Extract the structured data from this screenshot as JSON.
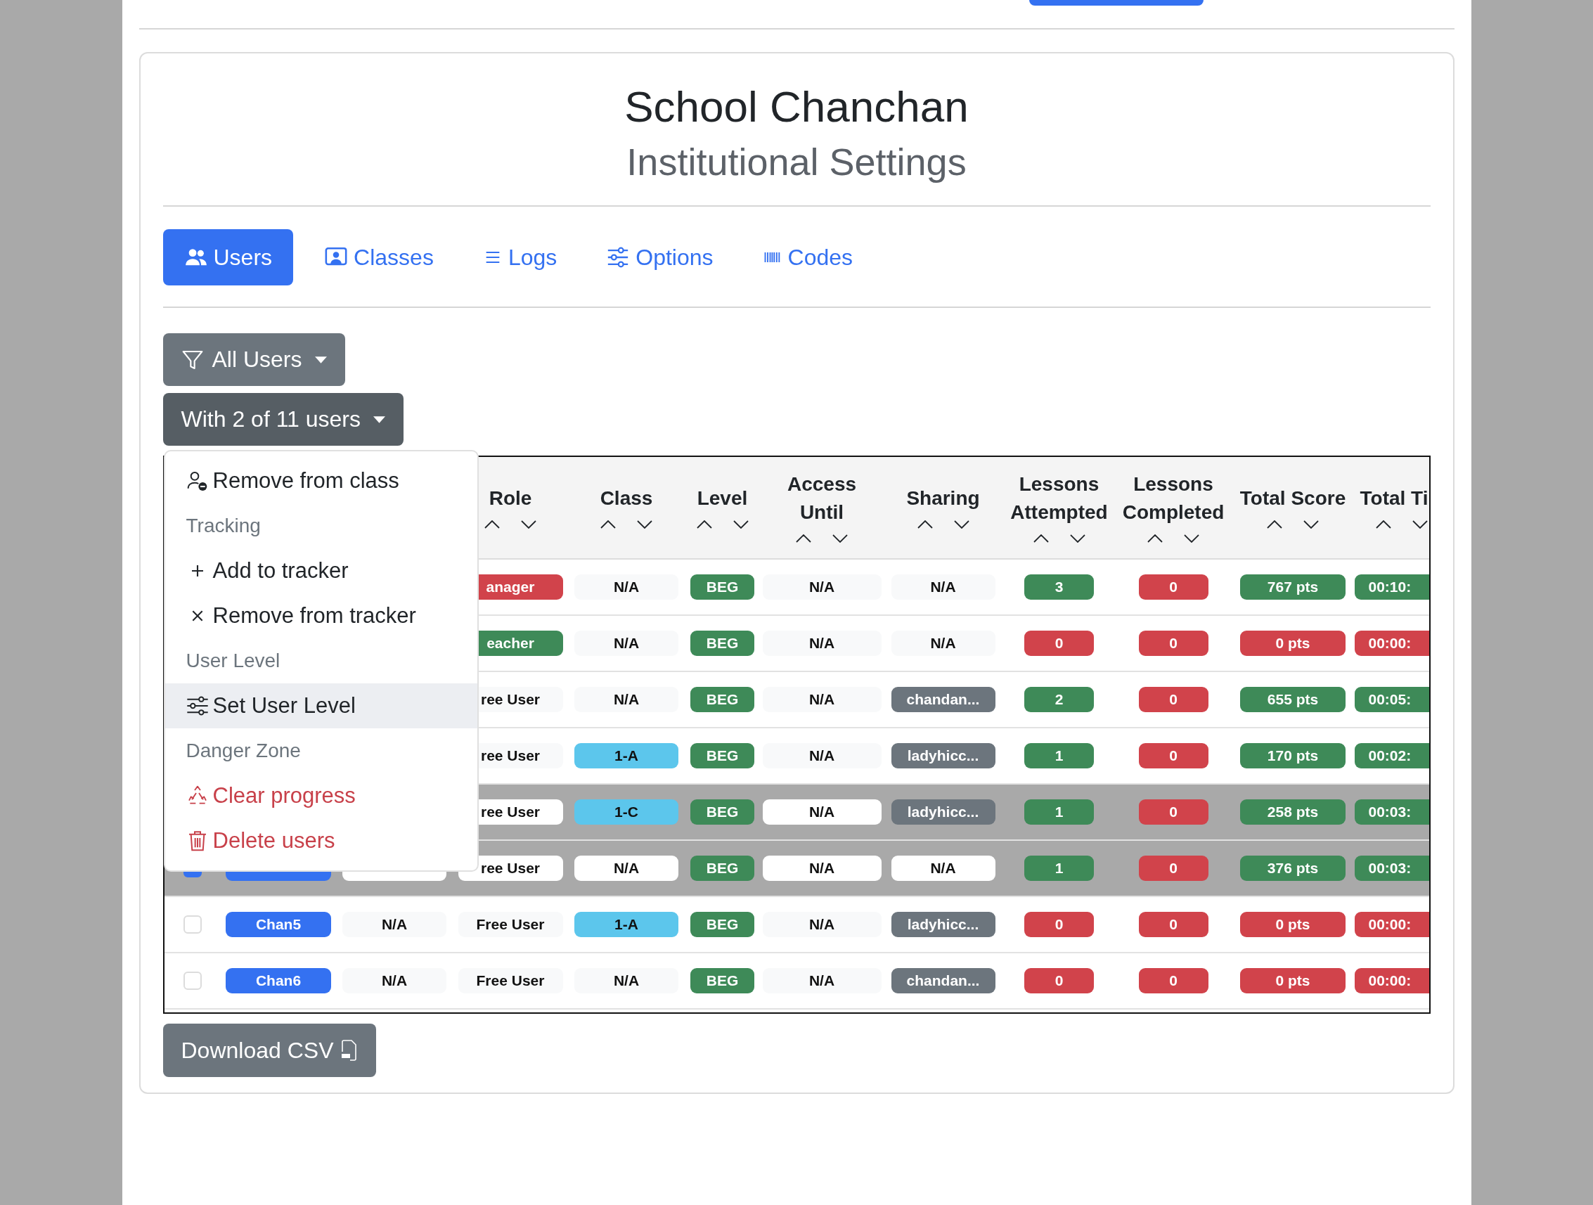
{
  "header": {
    "title": "School Chanchan",
    "subtitle": "Institutional Settings"
  },
  "tabs": [
    {
      "label": "Users",
      "selected": true
    },
    {
      "label": "Classes",
      "selected": false
    },
    {
      "label": "Logs",
      "selected": false
    },
    {
      "label": "Options",
      "selected": false
    },
    {
      "label": "Codes",
      "selected": false
    }
  ],
  "filters": [
    {
      "label": "All Users",
      "kind": "filter"
    },
    {
      "label": "With 2 of 11 users",
      "kind": "action"
    }
  ],
  "action_menu": [
    {
      "kind": "item",
      "label": "Remove from class",
      "selected": false
    },
    {
      "kind": "header",
      "label": "Tracking"
    },
    {
      "kind": "item",
      "label": "Add to tracker",
      "selected": false
    },
    {
      "kind": "item",
      "label": "Remove from tracker",
      "selected": false
    },
    {
      "kind": "header",
      "label": "User Level"
    },
    {
      "kind": "item",
      "label": "Set User Level",
      "selected": true
    },
    {
      "kind": "header",
      "label": "Danger Zone"
    },
    {
      "kind": "danger",
      "label": "Clear progress",
      "selected": false
    },
    {
      "kind": "danger",
      "label": "Delete users",
      "selected": false
    }
  ],
  "table": {
    "columns": [
      {
        "label": "Role"
      },
      {
        "label": "Class"
      },
      {
        "label": "Level"
      },
      {
        "label": "Access Until"
      },
      {
        "label": "Sharing"
      },
      {
        "label": "Lessons Attempted"
      },
      {
        "label": "Lessons Completed"
      },
      {
        "label": "Total Score"
      },
      {
        "label": "Total Ti"
      }
    ],
    "rows": [
      {
        "selected": false,
        "role": {
          "text": "anager",
          "color": "#d1434b"
        },
        "class": {
          "text": "N/A",
          "color": "#f8f9fa"
        },
        "level": {
          "text": "BEG",
          "color": "#3e8a58"
        },
        "access_until": {
          "text": "N/A",
          "color": "#f8f9fa"
        },
        "sharing": {
          "text": "N/A",
          "color": "#f8f9fa"
        },
        "lessons_attempted": {
          "text": "3",
          "color": "#3e8a58"
        },
        "lessons_completed": {
          "text": "0",
          "color": "#d1434b"
        },
        "total_score": {
          "text": "767 pts",
          "color": "#3e8a58"
        },
        "total_time": {
          "text": "00:10:",
          "color": "#3e8a58"
        }
      },
      {
        "selected": false,
        "role": {
          "text": "eacher",
          "color": "#3e8a58"
        },
        "class": {
          "text": "N/A",
          "color": "#f8f9fa"
        },
        "level": {
          "text": "BEG",
          "color": "#3e8a58"
        },
        "access_until": {
          "text": "N/A",
          "color": "#f8f9fa"
        },
        "sharing": {
          "text": "N/A",
          "color": "#f8f9fa"
        },
        "lessons_attempted": {
          "text": "0",
          "color": "#d1434b"
        },
        "lessons_completed": {
          "text": "0",
          "color": "#d1434b"
        },
        "total_score": {
          "text": "0 pts",
          "color": "#d1434b"
        },
        "total_time": {
          "text": "00:00:",
          "color": "#d1434b"
        }
      },
      {
        "selected": false,
        "role": {
          "text": "ree User",
          "color": "#f8f9fa"
        },
        "class": {
          "text": "N/A",
          "color": "#f8f9fa"
        },
        "level": {
          "text": "BEG",
          "color": "#3e8a58"
        },
        "access_until": {
          "text": "N/A",
          "color": "#f8f9fa"
        },
        "sharing": {
          "text": "chandan...",
          "color": "#6c757d"
        },
        "lessons_attempted": {
          "text": "2",
          "color": "#3e8a58"
        },
        "lessons_completed": {
          "text": "0",
          "color": "#d1434b"
        },
        "total_score": {
          "text": "655 pts",
          "color": "#3e8a58"
        },
        "total_time": {
          "text": "00:05:",
          "color": "#3e8a58"
        }
      },
      {
        "selected": false,
        "role": {
          "text": "ree User",
          "color": "#f8f9fa"
        },
        "class": {
          "text": "1-A",
          "color": "#5cc6ec"
        },
        "level": {
          "text": "BEG",
          "color": "#3e8a58"
        },
        "access_until": {
          "text": "N/A",
          "color": "#f8f9fa"
        },
        "sharing": {
          "text": "ladyhicc...",
          "color": "#6c757d"
        },
        "lessons_attempted": {
          "text": "1",
          "color": "#3e8a58"
        },
        "lessons_completed": {
          "text": "0",
          "color": "#d1434b"
        },
        "total_score": {
          "text": "170 pts",
          "color": "#3e8a58"
        },
        "total_time": {
          "text": "00:02:",
          "color": "#3e8a58"
        }
      },
      {
        "selected": true,
        "role": {
          "text": "ree User",
          "color": "#ffffff"
        },
        "class": {
          "text": "1-C",
          "color": "#5cc6ec"
        },
        "level": {
          "text": "BEG",
          "color": "#3e8a58"
        },
        "access_until": {
          "text": "N/A",
          "color": "#ffffff"
        },
        "sharing": {
          "text": "ladyhicc...",
          "color": "#6c757d"
        },
        "lessons_attempted": {
          "text": "1",
          "color": "#3e8a58"
        },
        "lessons_completed": {
          "text": "0",
          "color": "#d1434b"
        },
        "total_score": {
          "text": "258 pts",
          "color": "#3e8a58"
        },
        "total_time": {
          "text": "00:03:",
          "color": "#3e8a58"
        }
      },
      {
        "selected": true,
        "checked": true,
        "name": {
          "color": "#3471f1"
        },
        "column_3": {
          "color": "#ffffff"
        },
        "role": {
          "text": "ree User",
          "color": "#ffffff"
        },
        "class": {
          "text": "N/A",
          "color": "#ffffff"
        },
        "level": {
          "text": "BEG",
          "color": "#3e8a58"
        },
        "access_until": {
          "text": "N/A",
          "color": "#ffffff"
        },
        "sharing": {
          "text": "N/A",
          "color": "#ffffff"
        },
        "lessons_attempted": {
          "text": "1",
          "color": "#3e8a58"
        },
        "lessons_completed": {
          "text": "0",
          "color": "#d1434b"
        },
        "total_score": {
          "text": "376 pts",
          "color": "#3e8a58"
        },
        "total_time": {
          "text": "00:03:",
          "color": "#3e8a58"
        }
      },
      {
        "selected": false,
        "checked": false,
        "name": {
          "text": "Chan5",
          "color": "#3471f1"
        },
        "column_3": {
          "text": "N/A",
          "color": "#f8f9fa"
        },
        "role": {
          "text": "Free User",
          "color": "#f8f9fa"
        },
        "class": {
          "text": "1-A",
          "color": "#5cc6ec"
        },
        "level": {
          "text": "BEG",
          "color": "#3e8a58"
        },
        "access_until": {
          "text": "N/A",
          "color": "#f8f9fa"
        },
        "sharing": {
          "text": "ladyhicc...",
          "color": "#6c757d"
        },
        "lessons_attempted": {
          "text": "0",
          "color": "#d1434b"
        },
        "lessons_completed": {
          "text": "0",
          "color": "#d1434b"
        },
        "total_score": {
          "text": "0 pts",
          "color": "#d1434b"
        },
        "total_time": {
          "text": "00:00:",
          "color": "#d1434b"
        }
      },
      {
        "selected": false,
        "checked": false,
        "name": {
          "text": "Chan6",
          "color": "#3471f1"
        },
        "column_3": {
          "text": "N/A",
          "color": "#f8f9fa"
        },
        "role": {
          "text": "Free User",
          "color": "#f8f9fa"
        },
        "class": {
          "text": "N/A",
          "color": "#f8f9fa"
        },
        "level": {
          "text": "BEG",
          "color": "#3e8a58"
        },
        "access_until": {
          "text": "N/A",
          "color": "#f8f9fa"
        },
        "sharing": {
          "text": "chandan...",
          "color": "#6c757d"
        },
        "lessons_attempted": {
          "text": "0",
          "color": "#d1434b"
        },
        "lessons_completed": {
          "text": "0",
          "color": "#d1434b"
        },
        "total_score": {
          "text": "0 pts",
          "color": "#d1434b"
        },
        "total_time": {
          "text": "00:00:",
          "color": "#d1434b"
        }
      }
    ]
  },
  "download_button": {
    "label": "Download CSV"
  }
}
